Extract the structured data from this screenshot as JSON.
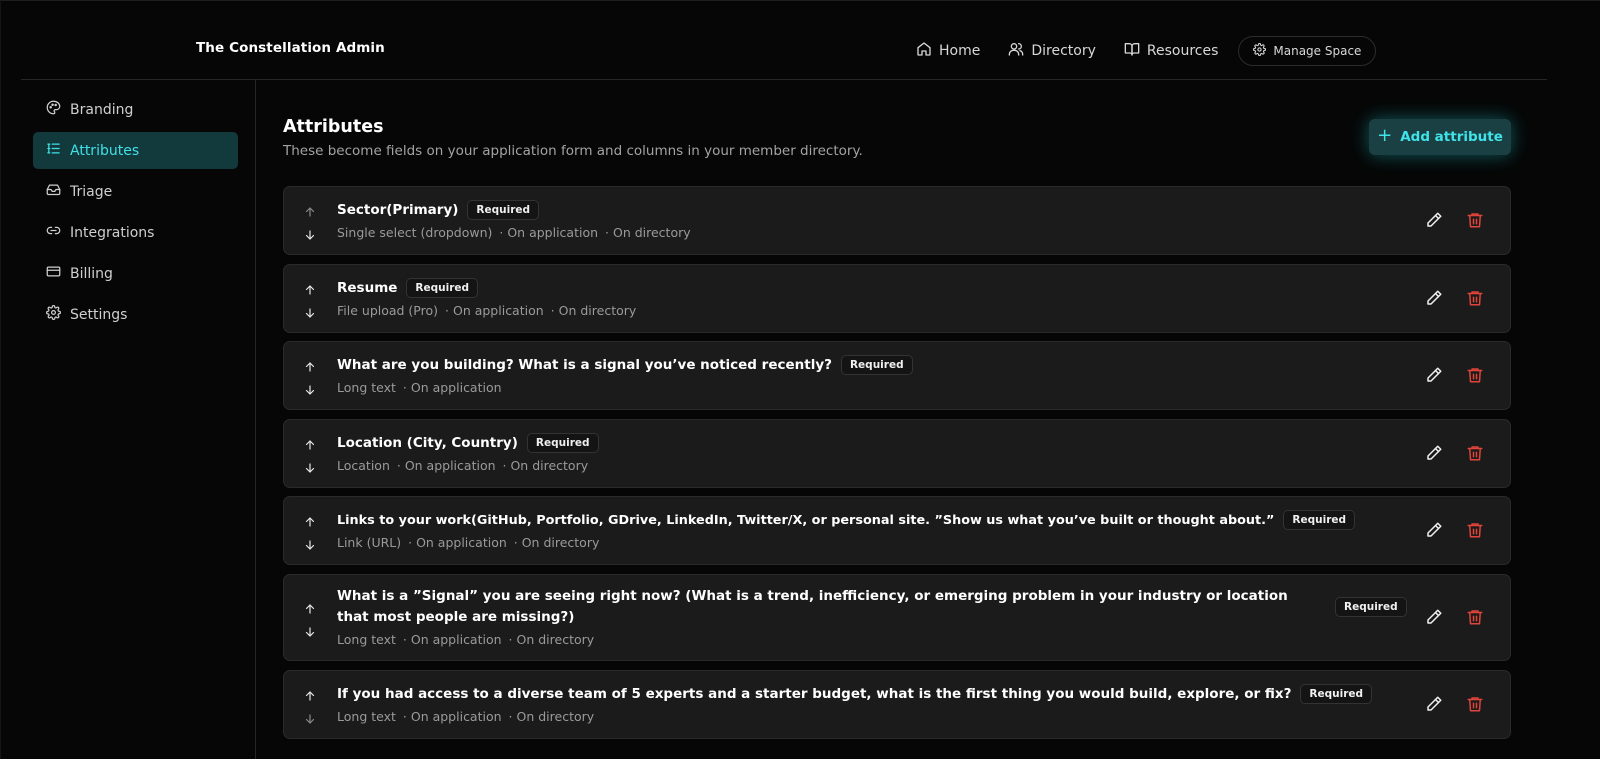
{
  "header": {
    "brand": "The Constellation Admin",
    "nav": [
      {
        "label": "Home",
        "icon": "home-icon"
      },
      {
        "label": "Directory",
        "icon": "users-icon"
      },
      {
        "label": "Resources",
        "icon": "book-icon"
      }
    ],
    "manage_label": "Manage Space"
  },
  "sidebar": {
    "items": [
      {
        "label": "Branding",
        "icon": "palette-icon",
        "active": false
      },
      {
        "label": "Attributes",
        "icon": "list-icon",
        "active": true
      },
      {
        "label": "Triage",
        "icon": "inbox-icon",
        "active": false
      },
      {
        "label": "Integrations",
        "icon": "link-icon",
        "active": false
      },
      {
        "label": "Billing",
        "icon": "card-icon",
        "active": false
      },
      {
        "label": "Settings",
        "icon": "gear-icon",
        "active": false
      }
    ]
  },
  "main": {
    "title": "Attributes",
    "subtitle": "These become fields on your application form and columns in your member directory.",
    "add_label": "Add attribute",
    "required_label": "Required",
    "attributes": [
      {
        "title": "Sector(Primary)",
        "meta": [
          "Single select (dropdown)",
          "· On application",
          "· On directory"
        ]
      },
      {
        "title": "Resume",
        "meta": [
          "File upload (Pro)",
          "· On application",
          "· On directory"
        ]
      },
      {
        "title": "What are you building? What is a signal you’ve noticed recently?",
        "meta": [
          "Long text",
          "· On application"
        ]
      },
      {
        "title": "Location (City, Country)",
        "meta": [
          "Location",
          "· On application",
          "· On directory"
        ]
      },
      {
        "title": "Links to your work(GitHub, Portfolio, GDrive, LinkedIn, Twitter/X, or personal site. ”Show us what you’ve built or thought about.”",
        "meta": [
          "Link (URL)",
          "· On application",
          "· On directory"
        ]
      },
      {
        "title": "What is a ”Signal” you are seeing right now? (What is a trend, inefficiency, or emerging problem in your industry or location that most people are missing?)",
        "meta": [
          "Long text",
          "· On application",
          "· On directory"
        ]
      },
      {
        "title": "If you had access to a diverse team of 5 experts and a starter budget, what is the first thing you would build, explore, or fix?",
        "meta": [
          "Long text",
          "· On application",
          "· On directory"
        ]
      }
    ]
  },
  "colors": {
    "accent": "#3fe0e6",
    "danger": "#e0443a"
  }
}
